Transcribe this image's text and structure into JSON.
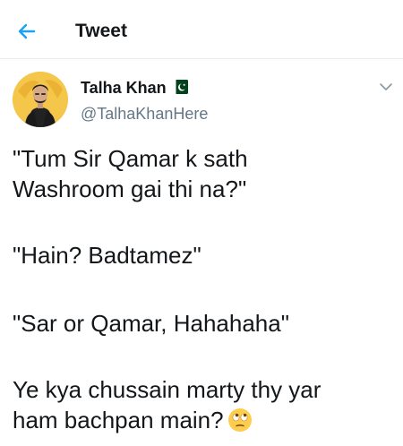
{
  "header": {
    "title": "Tweet",
    "back_icon": "arrow-left-icon",
    "accent_color": "#1da1f2"
  },
  "tweet": {
    "author": {
      "name": "Talha Khan",
      "handle": "@TalhaKhanHere",
      "badge_icon": "pakistan-flag-icon"
    },
    "menu_icon": "chevron-down-icon",
    "text": {
      "para1": {
        "line1": "\"Tum Sir Qamar k sath",
        "line2": "Washroom gai thi na?\""
      },
      "para2": "\"Hain? Badtamez\"",
      "para3": "\"Sar or Qamar, Hahahaha\"",
      "para4": {
        "line1": "Ye kya chussain marty thy yar",
        "line2": "ham bachpan main?"
      },
      "emoji": "face-with-rolling-eyes-icon"
    }
  }
}
